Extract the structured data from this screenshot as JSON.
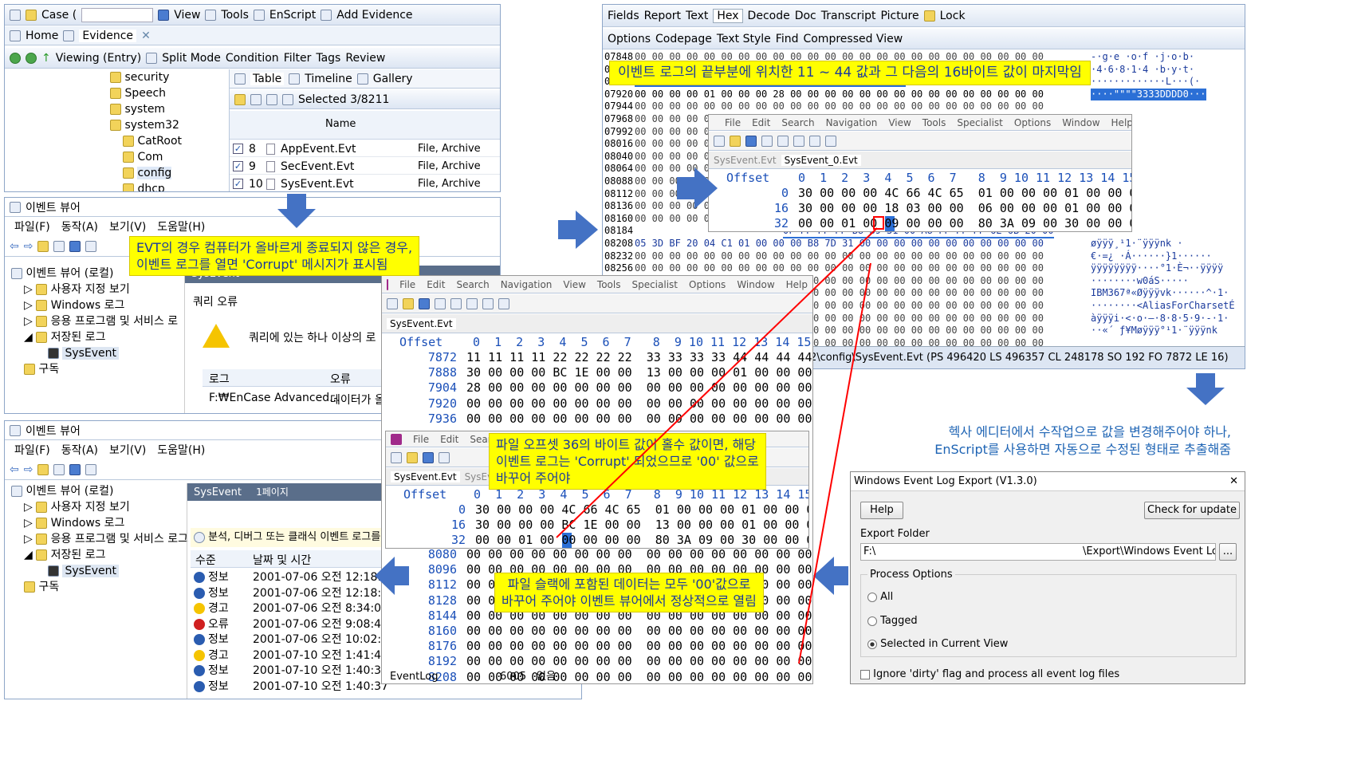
{
  "encase": {
    "toolbar": [
      "Case (",
      "View",
      "Tools",
      "EnScript",
      "Add Evidence"
    ],
    "tabs": [
      "Home",
      "Evidence"
    ],
    "nav": [
      "Viewing (Entry)",
      "Split Mode",
      "Condition",
      "Filter",
      "Tags",
      "Review"
    ],
    "tree": [
      "security",
      "Speech",
      "system",
      "system32",
      "CatRoot",
      "Com",
      "config",
      "dhcp"
    ],
    "view_tabs": [
      "Table",
      "Timeline",
      "Gallery"
    ],
    "selected": "Selected 3/8211",
    "col_name": "Name",
    "rows": [
      {
        "n": "8",
        "name": "AppEvent.Evt",
        "type": "File, Archive"
      },
      {
        "n": "9",
        "name": "SecEvent.Evt",
        "type": "File, Archive"
      },
      {
        "n": "10",
        "name": "SysEvent.Evt",
        "type": "File, Archive"
      }
    ]
  },
  "hexmain": {
    "tabs": [
      "Fields",
      "Report",
      "Text",
      "Hex",
      "Decode",
      "Doc",
      "Transcript",
      "Picture",
      "Lock"
    ],
    "tools": [
      "Options",
      "Codepage",
      "Text Style",
      "Find",
      "Compressed View"
    ],
    "offsets": [
      "07848",
      "07872",
      "07896",
      "07920",
      "07944",
      "07968",
      "07992",
      "08016",
      "08040",
      "08064",
      "08088",
      "08112",
      "08136",
      "08160",
      "08184",
      "08208",
      "08232",
      "08256",
      "08280",
      "08304",
      "08328",
      "08352",
      "08376",
      "08400"
    ],
    "r1": "11 11 11 11 22 22 22 22 33 33 33 33 44 44 44 44",
    "r1b": "30 00 00 00 BC 1E 00 00",
    "r2": "00 00 00 00 01 00 00 00 28 00 00 00 00 00 00 00 00 00 00 00 00 00 00 00",
    "r3": "0F FF FF FF B8 B9 31 00 A8 FF FF FF 6E 6B 20 00",
    "r4": "05 3D BF 20 04 C1 01 00 00 00 B8 7D 31 00 00 00 00 00 00 00 00 00 00 00",
    "ascii": [
      "-·g·e ·o·f ·j·o·b·",
      "·4·6·8·1·4 ·b·y·t·",
      "·············L···(·",
      "····\"\"\"\"3333DDDD0···",
      "",
      "",
      "",
      "",
      "",
      "",
      "",
      "",
      "",
      "",
      "",
      "øÿÿÿ¸¹1·¨ÿÿÿnk ·",
      "€·=¿ ·Á······}1······",
      "ÿÿÿÿÿÿÿÿ····°1·È¬··ÿÿÿÿ",
      "········w0áS·····",
      "IBM367ª«Øÿÿÿvk······^·1·",
      "········<AliasForCharsetÉ",
      "àÿÿÿi·<·o·—·8·8·5·9·-·1·",
      "··«´ ƒ¥Møÿÿÿ°¹1·¨ÿÿÿnk"
    ],
    "status": "2\\config\\SysEvent.Evt (PS 496420 LS 496357 CL 248178 SO 192 FO 7872 LE 16)"
  },
  "hexed_small": {
    "menu": [
      "File",
      "Edit",
      "Search",
      "Navigation",
      "View",
      "Tools",
      "Specialist",
      "Options",
      "Window",
      "Help"
    ],
    "tabs": [
      "SysEvent.Evt",
      "SysEvent_0.Evt"
    ],
    "header": "Offset",
    "cols": "0  1  2  3  4  5  6  7   8  9 10 11 12 13 14 15",
    "rows": [
      {
        "o": "0",
        "h": "30 00 00 00 4C 66 4C 65  01 00 00 00 01 00 00 00"
      },
      {
        "o": "16",
        "h": "30 00 00 00 18 03 00 00  06 00 00 00 01 00 00 00"
      },
      {
        "o": "32",
        "h": "00 00 01 00 09 00 00 00  80 3A 09 00 30 00 00 00"
      }
    ]
  },
  "hexed_mid": {
    "menu": [
      "File",
      "Edit",
      "Search",
      "Navigation",
      "View",
      "Tools",
      "Specialist",
      "Options",
      "Window",
      "Help"
    ],
    "tab": "SysEvent.Evt",
    "header": "Offset",
    "cols": "0  1  2  3  4  5  6  7   8  9 10 11 12 13 14 15",
    "rows": [
      {
        "o": "7872",
        "h": "11 11 11 11 22 22 22 22  33 33 33 33 44 44 44 44"
      },
      {
        "o": "7888",
        "h": "30 00 00 00 BC 1E 00 00  13 00 00 00 01 00 00 00"
      },
      {
        "o": "7904",
        "h": "28 00 00 00 00 00 00 00  00 00 00 00 00 00 00 00"
      },
      {
        "o": "7920",
        "h": "00 00 00 00 00 00 00 00  00 00 00 00 00 00 00 00"
      },
      {
        "o": "7936",
        "h": "00 00 00 00 00 00 00 00  00 00 00 00 00 00 00 00"
      }
    ],
    "rows2": [
      {
        "o": "8080",
        "h": "00 00 00 00 00 00 00 00  00 00 00 00 00 00 00 00"
      },
      {
        "o": "8096",
        "h": "00 00 00 00 00 00 00 00  00 00 00 00 00 00 00 00"
      },
      {
        "o": "8112",
        "h": "00 00 00 00 00 00 00 00  00 00 00 00 00 00 00 00"
      },
      {
        "o": "8128",
        "h": "00 00 00 00 00 00 00 00  00 00 00 00 00 00 00 00"
      },
      {
        "o": "8144",
        "h": "00 00 00 00 00 00 00 00  00 00 00 00 00 00 00 00"
      },
      {
        "o": "8160",
        "h": "00 00 00 00 00 00 00 00  00 00 00 00 00 00 00 00"
      },
      {
        "o": "8176",
        "h": "00 00 00 00 00 00 00 00  00 00 00 00 00 00 00 00"
      },
      {
        "o": "8192",
        "h": "00 00 00 00 00 00 00 00  00 00 00 00 00 00 00 00"
      },
      {
        "o": "8208",
        "h": "00 00 00 00 00 00 00 00  00 00 00 00 00 00 00 00"
      }
    ],
    "eventlog": "EventLog",
    "code": "6005",
    "none": "없음"
  },
  "hexed_inner": {
    "menu": [
      "File",
      "Edit",
      "Search"
    ],
    "tabs": [
      "SysEvent.Evt",
      "SysEvent"
    ],
    "header": "Offset",
    "cols": "0  1  2  3  4  5  6  7   8  9 10 11 12 13 14 15",
    "rows": [
      {
        "o": "0",
        "h": "30 00 00 00 4C 66 4C 65  01 00 00 00 01 00 00 00"
      },
      {
        "o": "16",
        "h": "30 00 00 00 BC 1E 00 00  13 00 00 00 01 00 00 00"
      },
      {
        "o": "32",
        "h": "00 00 01 00 00 00 00 00  80 3A 09 00 30 00 00 00"
      }
    ]
  },
  "ev1": {
    "title": "이벤트 뷰어",
    "menu": [
      "파일(F)",
      "동작(A)",
      "보기(V)",
      "도움말(H)"
    ],
    "tree": [
      "이벤트 뷰어 (로컬)",
      "사용자 지정 보기",
      "Windows 로그",
      "응용 프로그램 및 서비스 로",
      "저장된 로그",
      "SysEvent",
      "구독"
    ],
    "panel": "SysEvent",
    "err_title": "쿼리 오류",
    "err_msg": "쿼리에 있는 하나 이상의 로",
    "col_log": "로그",
    "col_err": "오류",
    "log_path": "F:₩EnCase Advanced...",
    "err_val": "데이터가 올"
  },
  "ev2": {
    "title": "이벤트 뷰어",
    "menu": [
      "파일(F)",
      "동작(A)",
      "보기(V)",
      "도움말(H)"
    ],
    "tree": [
      "이벤트 뷰어 (로컬)",
      "사용자 지정 보기",
      "Windows 로그",
      "응용 프로그램 및 서비스 로그",
      "저장된 로그",
      "SysEvent",
      "구독"
    ],
    "panel": "SysEvent",
    "page": "1페이지",
    "info": "분석, 디버그 또는 클래식 이벤트 로그를",
    "col_level": "수준",
    "col_date": "날짜 및 시간",
    "events": [
      {
        "level": "정보",
        "date": "2001-07-06 오전 12:18:23",
        "k": "i"
      },
      {
        "level": "정보",
        "date": "2001-07-06 오전 12:18:23",
        "k": "i"
      },
      {
        "level": "경고",
        "date": "2001-07-06 오전 8:34:01",
        "k": "w"
      },
      {
        "level": "오류",
        "date": "2001-07-06 오전 9:08:43",
        "k": "e"
      },
      {
        "level": "정보",
        "date": "2001-07-06 오전 10:02:23",
        "k": "i"
      },
      {
        "level": "경고",
        "date": "2001-07-10 오전 1:41:41",
        "k": "w"
      },
      {
        "level": "정보",
        "date": "2001-07-10 오전 1:40:37",
        "k": "i"
      },
      {
        "level": "정보",
        "date": "2001-07-10 오전 1:40:37",
        "k": "i"
      }
    ]
  },
  "export": {
    "title": "Windows Event Log Export (V1.3.0)",
    "help": "Help",
    "check": "Check for update",
    "folder_label": "Export Folder",
    "folder_a": "F:\\",
    "folder_b": "\\Export\\Windows Event Log E",
    "browse": "...",
    "options": "Process Options",
    "opt_all": "All",
    "opt_tagged": "Tagged",
    "opt_sel": "Selected in Current View",
    "dirty": "Ignore 'dirty' flag and process all event log files"
  },
  "callouts": {
    "c1": "이벤트 로그의 끝부분에 위치한 11 ~ 44 값과 그 다음의 16바이트 값이 마지막임",
    "c2a": "EVT의 경우 컴퓨터가 올바르게 종료되지 않은 경우,",
    "c2b": "이벤트 로그를 열면 'Corrupt' 메시지가 표시됨",
    "c3a": "파일 오프셋 36의 바이트 값이 홀수 값이면, 해당",
    "c3b": "이벤트 로그는 'Corrupt' 되었으므로 '00' 값으로",
    "c3c": "바꾸어 주어야",
    "c4a": "파일 슬랙에 포함된 데이터는 모두 '00'값으로",
    "c4b": "바꾸어 주어야 이벤트 뷰어에서 정상적으로 열림",
    "c5a": "헥사 에디터에서 수작업으로 값을 변경해주어야 하나,",
    "c5b": "EnScript를 사용하면 자동으로 수정된 형태로 추출해줌"
  },
  "colors": {
    "callout_bg": "#ffff00",
    "callout_text": "#1a3a9c",
    "arrow": "#4472c4",
    "red_line": "#ff0000",
    "selection": "#2b6fd6"
  }
}
